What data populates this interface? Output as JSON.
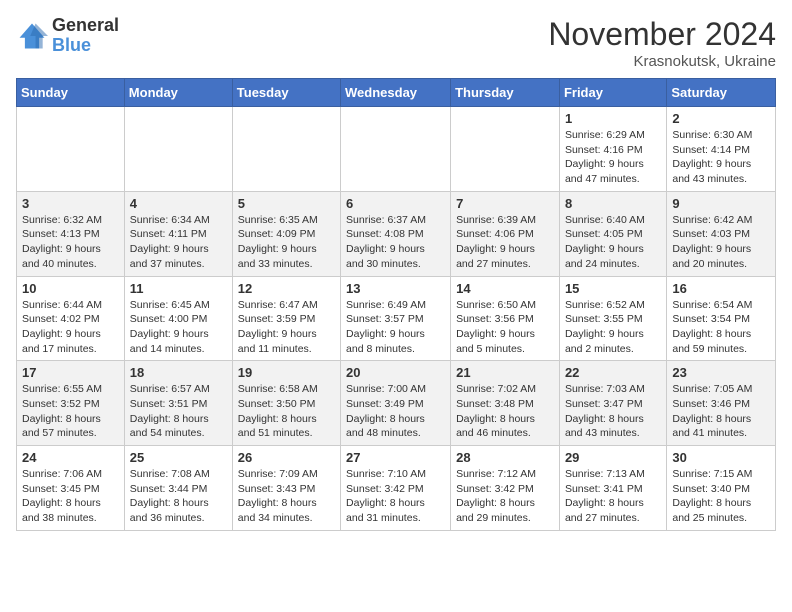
{
  "logo": {
    "line1": "General",
    "line2": "Blue"
  },
  "title": "November 2024",
  "subtitle": "Krasnokutsk, Ukraine",
  "weekdays": [
    "Sunday",
    "Monday",
    "Tuesday",
    "Wednesday",
    "Thursday",
    "Friday",
    "Saturday"
  ],
  "weeks": [
    [
      {
        "day": "",
        "info": ""
      },
      {
        "day": "",
        "info": ""
      },
      {
        "day": "",
        "info": ""
      },
      {
        "day": "",
        "info": ""
      },
      {
        "day": "",
        "info": ""
      },
      {
        "day": "1",
        "info": "Sunrise: 6:29 AM\nSunset: 4:16 PM\nDaylight: 9 hours\nand 47 minutes."
      },
      {
        "day": "2",
        "info": "Sunrise: 6:30 AM\nSunset: 4:14 PM\nDaylight: 9 hours\nand 43 minutes."
      }
    ],
    [
      {
        "day": "3",
        "info": "Sunrise: 6:32 AM\nSunset: 4:13 PM\nDaylight: 9 hours\nand 40 minutes."
      },
      {
        "day": "4",
        "info": "Sunrise: 6:34 AM\nSunset: 4:11 PM\nDaylight: 9 hours\nand 37 minutes."
      },
      {
        "day": "5",
        "info": "Sunrise: 6:35 AM\nSunset: 4:09 PM\nDaylight: 9 hours\nand 33 minutes."
      },
      {
        "day": "6",
        "info": "Sunrise: 6:37 AM\nSunset: 4:08 PM\nDaylight: 9 hours\nand 30 minutes."
      },
      {
        "day": "7",
        "info": "Sunrise: 6:39 AM\nSunset: 4:06 PM\nDaylight: 9 hours\nand 27 minutes."
      },
      {
        "day": "8",
        "info": "Sunrise: 6:40 AM\nSunset: 4:05 PM\nDaylight: 9 hours\nand 24 minutes."
      },
      {
        "day": "9",
        "info": "Sunrise: 6:42 AM\nSunset: 4:03 PM\nDaylight: 9 hours\nand 20 minutes."
      }
    ],
    [
      {
        "day": "10",
        "info": "Sunrise: 6:44 AM\nSunset: 4:02 PM\nDaylight: 9 hours\nand 17 minutes."
      },
      {
        "day": "11",
        "info": "Sunrise: 6:45 AM\nSunset: 4:00 PM\nDaylight: 9 hours\nand 14 minutes."
      },
      {
        "day": "12",
        "info": "Sunrise: 6:47 AM\nSunset: 3:59 PM\nDaylight: 9 hours\nand 11 minutes."
      },
      {
        "day": "13",
        "info": "Sunrise: 6:49 AM\nSunset: 3:57 PM\nDaylight: 9 hours\nand 8 minutes."
      },
      {
        "day": "14",
        "info": "Sunrise: 6:50 AM\nSunset: 3:56 PM\nDaylight: 9 hours\nand 5 minutes."
      },
      {
        "day": "15",
        "info": "Sunrise: 6:52 AM\nSunset: 3:55 PM\nDaylight: 9 hours\nand 2 minutes."
      },
      {
        "day": "16",
        "info": "Sunrise: 6:54 AM\nSunset: 3:54 PM\nDaylight: 8 hours\nand 59 minutes."
      }
    ],
    [
      {
        "day": "17",
        "info": "Sunrise: 6:55 AM\nSunset: 3:52 PM\nDaylight: 8 hours\nand 57 minutes."
      },
      {
        "day": "18",
        "info": "Sunrise: 6:57 AM\nSunset: 3:51 PM\nDaylight: 8 hours\nand 54 minutes."
      },
      {
        "day": "19",
        "info": "Sunrise: 6:58 AM\nSunset: 3:50 PM\nDaylight: 8 hours\nand 51 minutes."
      },
      {
        "day": "20",
        "info": "Sunrise: 7:00 AM\nSunset: 3:49 PM\nDaylight: 8 hours\nand 48 minutes."
      },
      {
        "day": "21",
        "info": "Sunrise: 7:02 AM\nSunset: 3:48 PM\nDaylight: 8 hours\nand 46 minutes."
      },
      {
        "day": "22",
        "info": "Sunrise: 7:03 AM\nSunset: 3:47 PM\nDaylight: 8 hours\nand 43 minutes."
      },
      {
        "day": "23",
        "info": "Sunrise: 7:05 AM\nSunset: 3:46 PM\nDaylight: 8 hours\nand 41 minutes."
      }
    ],
    [
      {
        "day": "24",
        "info": "Sunrise: 7:06 AM\nSunset: 3:45 PM\nDaylight: 8 hours\nand 38 minutes."
      },
      {
        "day": "25",
        "info": "Sunrise: 7:08 AM\nSunset: 3:44 PM\nDaylight: 8 hours\nand 36 minutes."
      },
      {
        "day": "26",
        "info": "Sunrise: 7:09 AM\nSunset: 3:43 PM\nDaylight: 8 hours\nand 34 minutes."
      },
      {
        "day": "27",
        "info": "Sunrise: 7:10 AM\nSunset: 3:42 PM\nDaylight: 8 hours\nand 31 minutes."
      },
      {
        "day": "28",
        "info": "Sunrise: 7:12 AM\nSunset: 3:42 PM\nDaylight: 8 hours\nand 29 minutes."
      },
      {
        "day": "29",
        "info": "Sunrise: 7:13 AM\nSunset: 3:41 PM\nDaylight: 8 hours\nand 27 minutes."
      },
      {
        "day": "30",
        "info": "Sunrise: 7:15 AM\nSunset: 3:40 PM\nDaylight: 8 hours\nand 25 minutes."
      }
    ]
  ]
}
